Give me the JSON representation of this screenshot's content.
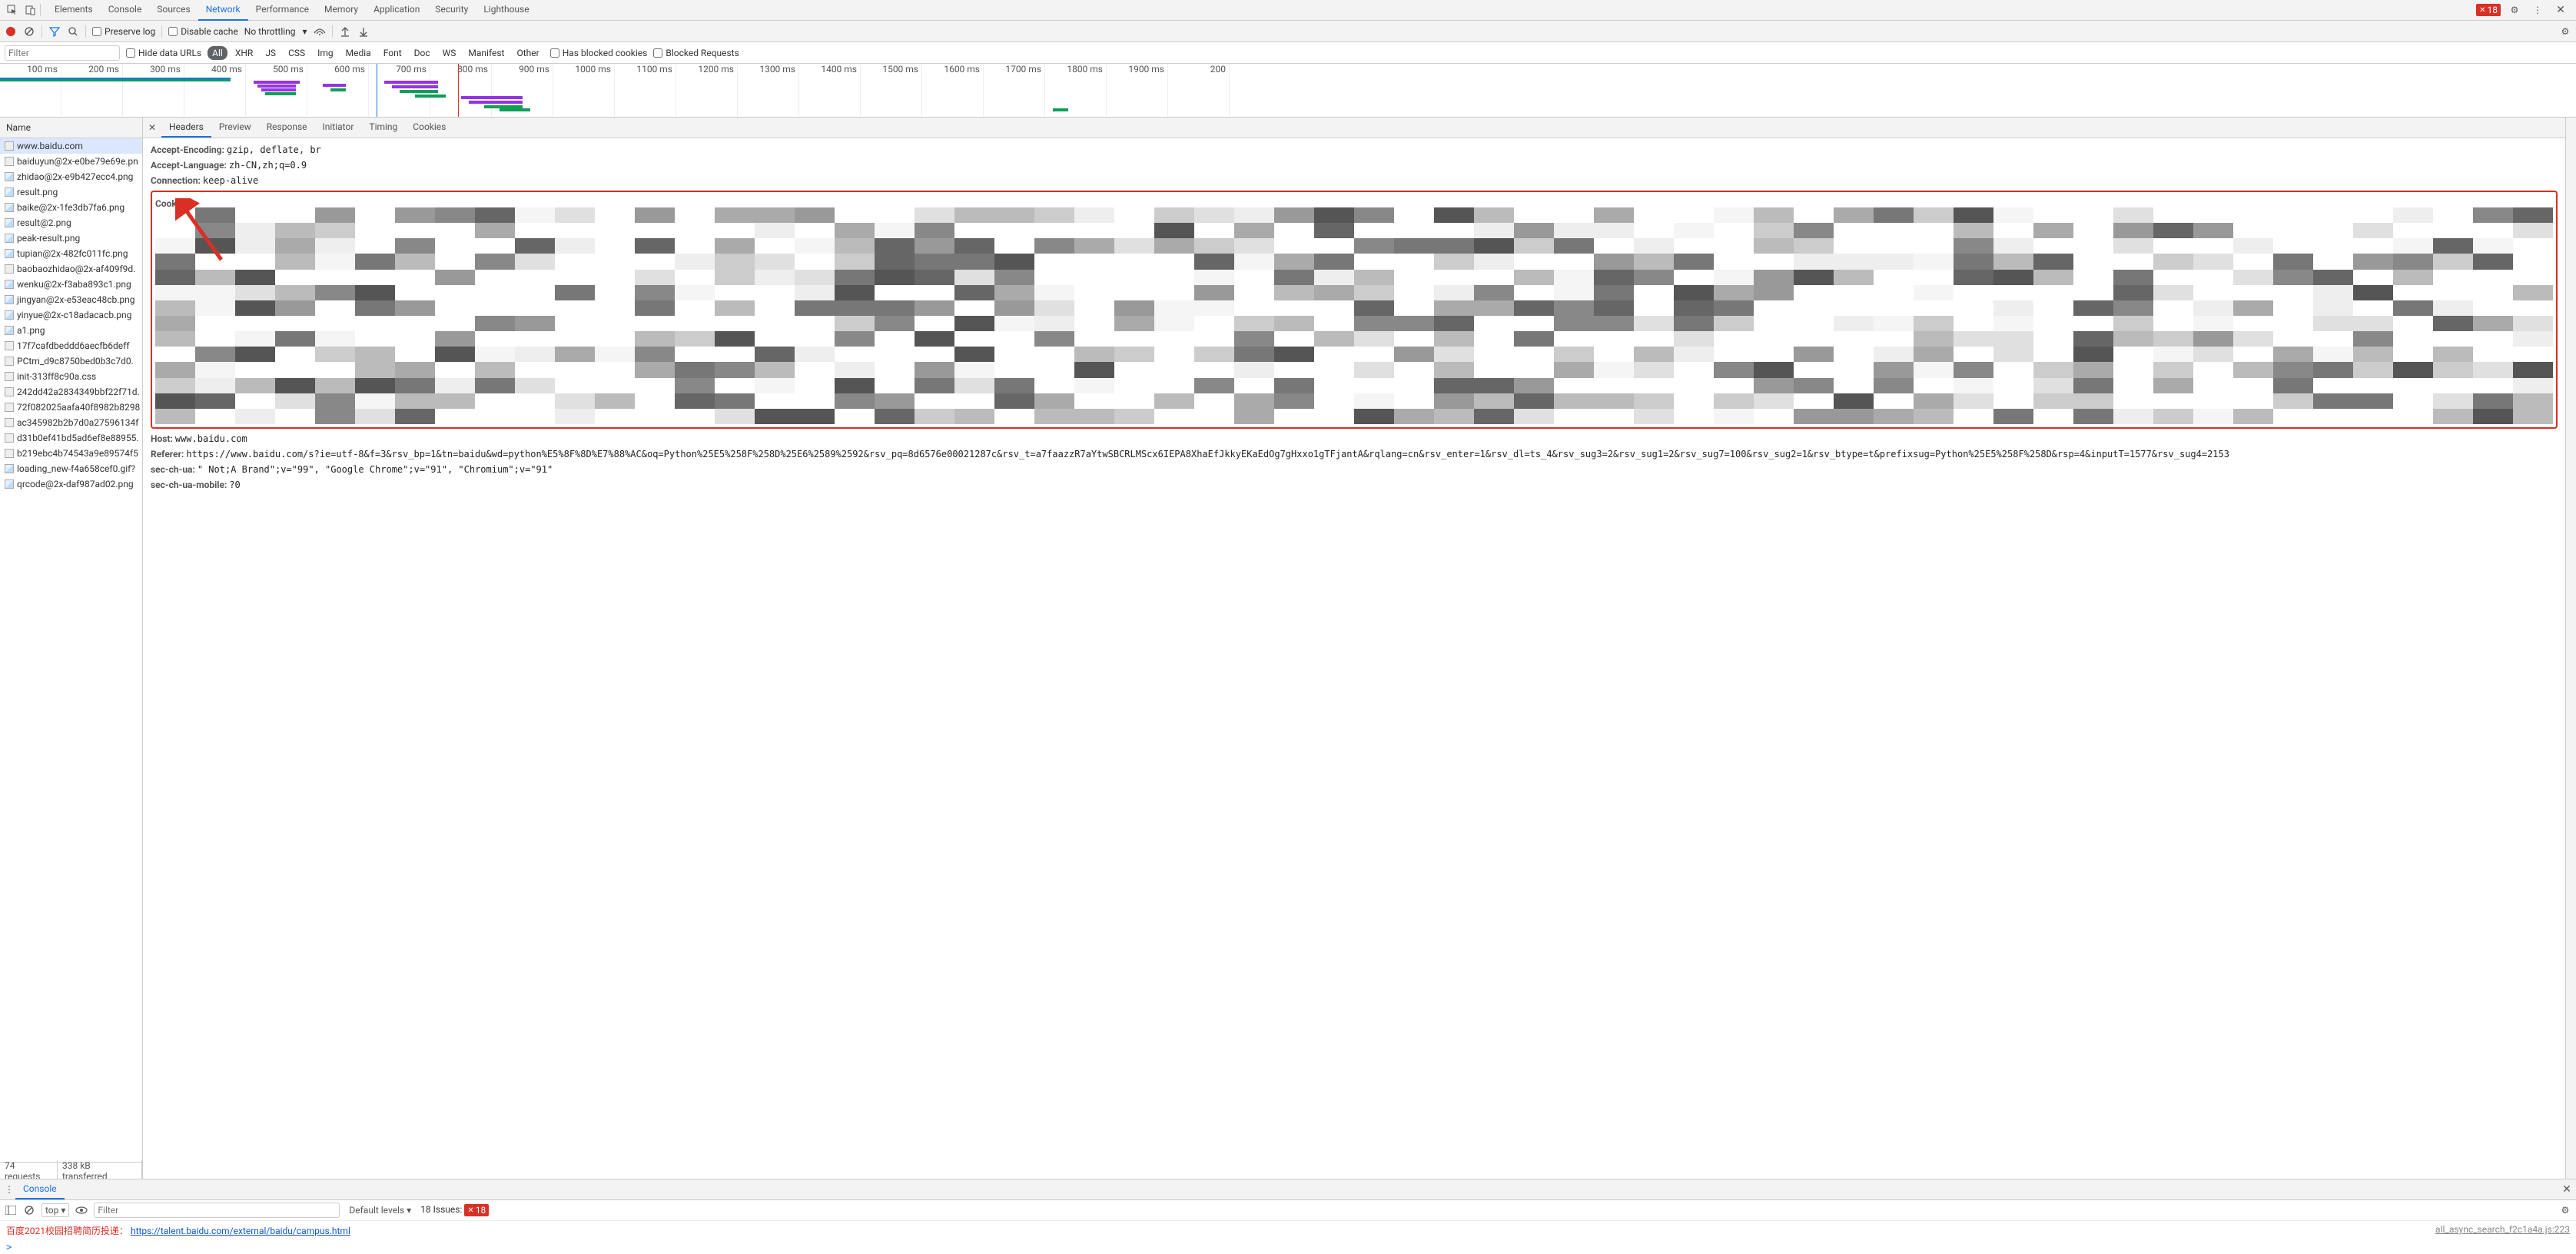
{
  "topbar": {
    "tabs": [
      "Elements",
      "Console",
      "Sources",
      "Network",
      "Performance",
      "Memory",
      "Application",
      "Security",
      "Lighthouse"
    ],
    "active": "Network",
    "issues_count": "18"
  },
  "toolbar": {
    "preserve_log": "Preserve log",
    "disable_cache": "Disable cache",
    "throttling": "No throttling"
  },
  "filterbar": {
    "filter_placeholder": "Filter",
    "hide_data_urls": "Hide data URLs",
    "types": [
      "All",
      "XHR",
      "JS",
      "CSS",
      "Img",
      "Media",
      "Font",
      "Doc",
      "WS",
      "Manifest",
      "Other"
    ],
    "active_type": "All",
    "has_blocked_cookies": "Has blocked cookies",
    "blocked_requests": "Blocked Requests"
  },
  "timeline": {
    "ticks": [
      "100 ms",
      "200 ms",
      "300 ms",
      "400 ms",
      "500 ms",
      "600 ms",
      "700 ms",
      "800 ms",
      "900 ms",
      "1000 ms",
      "1100 ms",
      "1200 ms",
      "1300 ms",
      "1400 ms",
      "1500 ms",
      "1600 ms",
      "1700 ms",
      "1800 ms",
      "1900 ms",
      "200"
    ]
  },
  "left": {
    "header": "Name",
    "requests": [
      "www.baidu.com",
      "baiduyun@2x-e0be79e69e.pn",
      "zhidao@2x-e9b427ecc4.png",
      "result.png",
      "baike@2x-1fe3db7fa6.png",
      "result@2.png",
      "peak-result.png",
      "tupian@2x-482fc011fc.png",
      "baobaozhidao@2x-af409f9d.",
      "wenku@2x-f3aba893c1.png",
      "jingyan@2x-e53eac48cb.png",
      "yinyue@2x-c18adacacb.png",
      "a1.png",
      "17f7cafdbeddd6aecfb6deff",
      "PCtm_d9c8750bed0b3c7d0.",
      "init-313ff8c90a.css",
      "242dd42a2834349bbf22f71d.",
      "72f082025aafa40f8982b8298",
      "ac345982b2b7d0a27596134f",
      "d31b0ef41bd5ad6ef8e88955.",
      "b219ebc4b74543a9e89574f5",
      "loading_new-f4a658cef0.gif?",
      "qrcode@2x-daf987ad02.png"
    ],
    "selected": 0,
    "footer": {
      "requests": "74 requests",
      "transferred": "338 kB transferred"
    }
  },
  "detail": {
    "tabs": [
      "Headers",
      "Preview",
      "Response",
      "Initiator",
      "Timing",
      "Cookies"
    ],
    "active": "Headers",
    "headers_pre": [
      {
        "k": "Accept-Encoding:",
        "v": "gzip, deflate, br"
      },
      {
        "k": "Accept-Language:",
        "v": "zh-CN,zh;q=0.9"
      },
      {
        "k": "Connection:",
        "v": "keep-alive"
      }
    ],
    "cookie_label": "Cookie:",
    "headers_post": [
      {
        "k": "Host:",
        "v": "www.baidu.com"
      },
      {
        "k": "Referer:",
        "v": "https://www.baidu.com/s?ie=utf-8&f=3&rsv_bp=1&tn=baidu&wd=python%E5%8F%8D%E7%88%AC&oq=Python%25E5%258F%258D%25E6%2589%2592&rsv_pq=8d6576e00021287c&rsv_t=a7faazzR7aYtwSBCRLMScx6IEPA8XhaEfJkkyEKaEdOg7gHxxo1gTFjantA&rqlang=cn&rsv_enter=1&rsv_dl=ts_4&rsv_sug3=2&rsv_sug1=2&rsv_sug7=100&rsv_sug2=1&rsv_btype=t&prefixsug=Python%25E5%258F%258D&rsp=4&inputT=1577&rsv_sug4=2153"
      },
      {
        "k": "sec-ch-ua:",
        "v": "\" Not;A Brand\";v=\"99\", \"Google Chrome\";v=\"91\", \"Chromium\";v=\"91\""
      },
      {
        "k": "sec-ch-ua-mobile:",
        "v": "?0"
      }
    ]
  },
  "console": {
    "tab": "Console",
    "top": "top ▾",
    "filter_placeholder": "Filter",
    "default_levels": "Default levels ▾",
    "issues_label": "18 Issues:",
    "issues_badge": "18",
    "log_prefix": "百度2021校园招聘简历投递：",
    "log_link": "https://talent.baidu.com/external/baidu/campus.html",
    "log_source": "all_async_search_f2c1a4a.js:223",
    "prompt": ">"
  }
}
